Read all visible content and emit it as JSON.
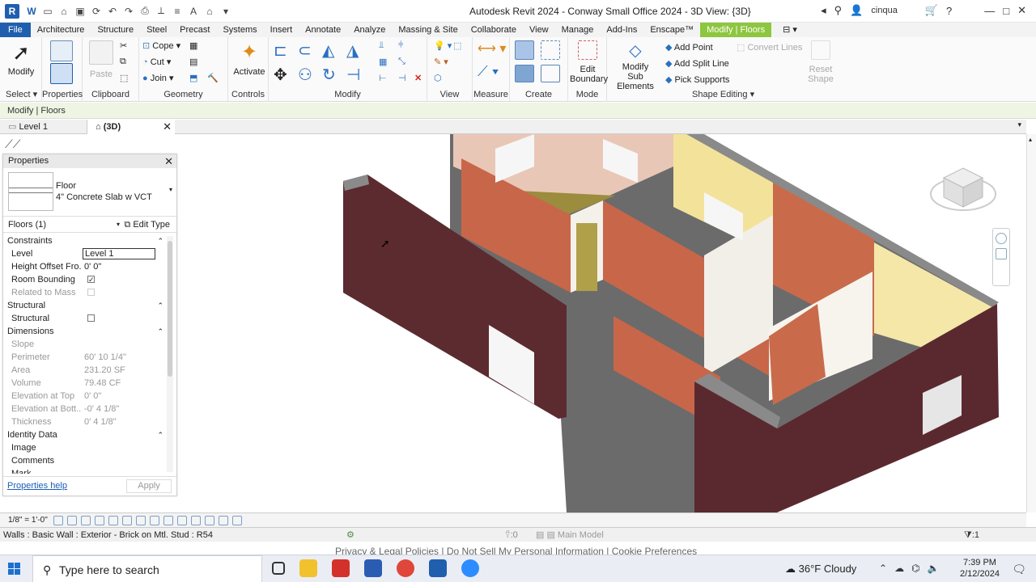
{
  "titlebar": {
    "app_letter": "R",
    "title": "Autodesk Revit 2024 - Conway Small Office 2024 - 3D View: {3D}",
    "user": "cinqua",
    "qat_icons": [
      "word-icon",
      "new-icon",
      "open-icon",
      "save-icon",
      "sync-icon",
      "undo-icon",
      "redo-icon",
      "print-icon",
      "measure-icon",
      "thin-lines-icon",
      "text-icon"
    ]
  },
  "tabs": [
    "File",
    "Architecture",
    "Structure",
    "Steel",
    "Precast",
    "Systems",
    "Insert",
    "Annotate",
    "Analyze",
    "Massing & Site",
    "Collaborate",
    "View",
    "Manage",
    "Add-Ins",
    "Enscape™",
    "Modify | Floors"
  ],
  "ribbon": {
    "select_panel": {
      "modify": "Modify",
      "label": "Select",
      "caret": "▾"
    },
    "properties_panel": {
      "label": "Properties"
    },
    "clipboard_panel": {
      "paste": "Paste",
      "label": "Clipboard"
    },
    "geometry_panel": {
      "cope": "Cope",
      "cut": "Cut",
      "join": "Join",
      "label": "Geometry"
    },
    "controls_panel": {
      "activate": "Activate",
      "label": "Controls"
    },
    "modify_panel": {
      "label": "Modify"
    },
    "view_panel": {
      "label": "View"
    },
    "measure_panel": {
      "label": "Measure"
    },
    "create_panel": {
      "label": "Create"
    },
    "mode_panel": {
      "edit_boundary_1": "Edit",
      "edit_boundary_2": "Boundary",
      "label": "Mode"
    },
    "shape_panel": {
      "modify_sub_1": "Modify",
      "modify_sub_2": "Sub Elements",
      "add_point": "Add Point",
      "add_split_line": "Add Split Line",
      "pick_supports": "Pick Supports",
      "convert_lines": "Convert Lines",
      "reset_shape_1": "Reset",
      "reset_shape_2": "Shape",
      "label": "Shape Editing",
      "caret": "▾"
    }
  },
  "context_row": "Modify | Floors",
  "view_tabs": [
    {
      "label": "Level 1"
    },
    {
      "label": "(3D)",
      "close": "✕"
    }
  ],
  "properties": {
    "title": "Properties",
    "close": "✕",
    "type_family": "Floor",
    "type_name": "4\" Concrete Slab w VCT",
    "instance_filter": "Floors (1)",
    "edit_type": "Edit Type",
    "sections": {
      "constraints": "Constraints",
      "structural": "Structural",
      "dimensions": "Dimensions",
      "identity": "Identity Data"
    },
    "rows": {
      "level": {
        "k": "Level",
        "v": "Level 1"
      },
      "height_offset": {
        "k": "Height Offset Fro...",
        "v": "0'  0\""
      },
      "room_bounding": {
        "k": "Room Bounding"
      },
      "related_mass": {
        "k": "Related to Mass"
      },
      "structural": {
        "k": "Structural"
      },
      "slope": {
        "k": "Slope",
        "v": ""
      },
      "perimeter": {
        "k": "Perimeter",
        "v": "60'  10 1/4\""
      },
      "area": {
        "k": "Area",
        "v": "231.20 SF"
      },
      "volume": {
        "k": "Volume",
        "v": "79.48 CF"
      },
      "elev_top": {
        "k": "Elevation at Top",
        "v": "0'  0\""
      },
      "elev_bottom": {
        "k": "Elevation at Bott...",
        "v": "-0'  4 1/8\""
      },
      "thickness": {
        "k": "Thickness",
        "v": "0'  4 1/8\""
      },
      "image": {
        "k": "Image",
        "v": ""
      },
      "comments": {
        "k": "Comments",
        "v": ""
      },
      "mark": {
        "k": "Mark",
        "v": ""
      }
    },
    "help": "Properties help",
    "apply": "Apply"
  },
  "viewbar": {
    "scale": "1/8\" = 1'-0\""
  },
  "status": {
    "left": "Walls : Basic Wall : Exterior - Brick on Mtl. Stud : R54",
    "zero": ":0",
    "model": "Main Model",
    "filter": ":1"
  },
  "privacy": {
    "a": "Privacy & Legal Policies",
    "b": "Do Not Sell My Personal Information",
    "c": "Cookie Preferences"
  },
  "taskbar": {
    "search_placeholder": "Type here to search",
    "weather": "36°F  Cloudy",
    "time": "7:39 PM",
    "date": "2/12/2024"
  },
  "colors": {
    "brand": "#1f5fae",
    "context_tab": "#8dc63f",
    "brick": "#5a2a2e",
    "terracotta": "#c8694a",
    "yellow_wall": "#f3e3a0",
    "floor": "#5c5c5c"
  }
}
